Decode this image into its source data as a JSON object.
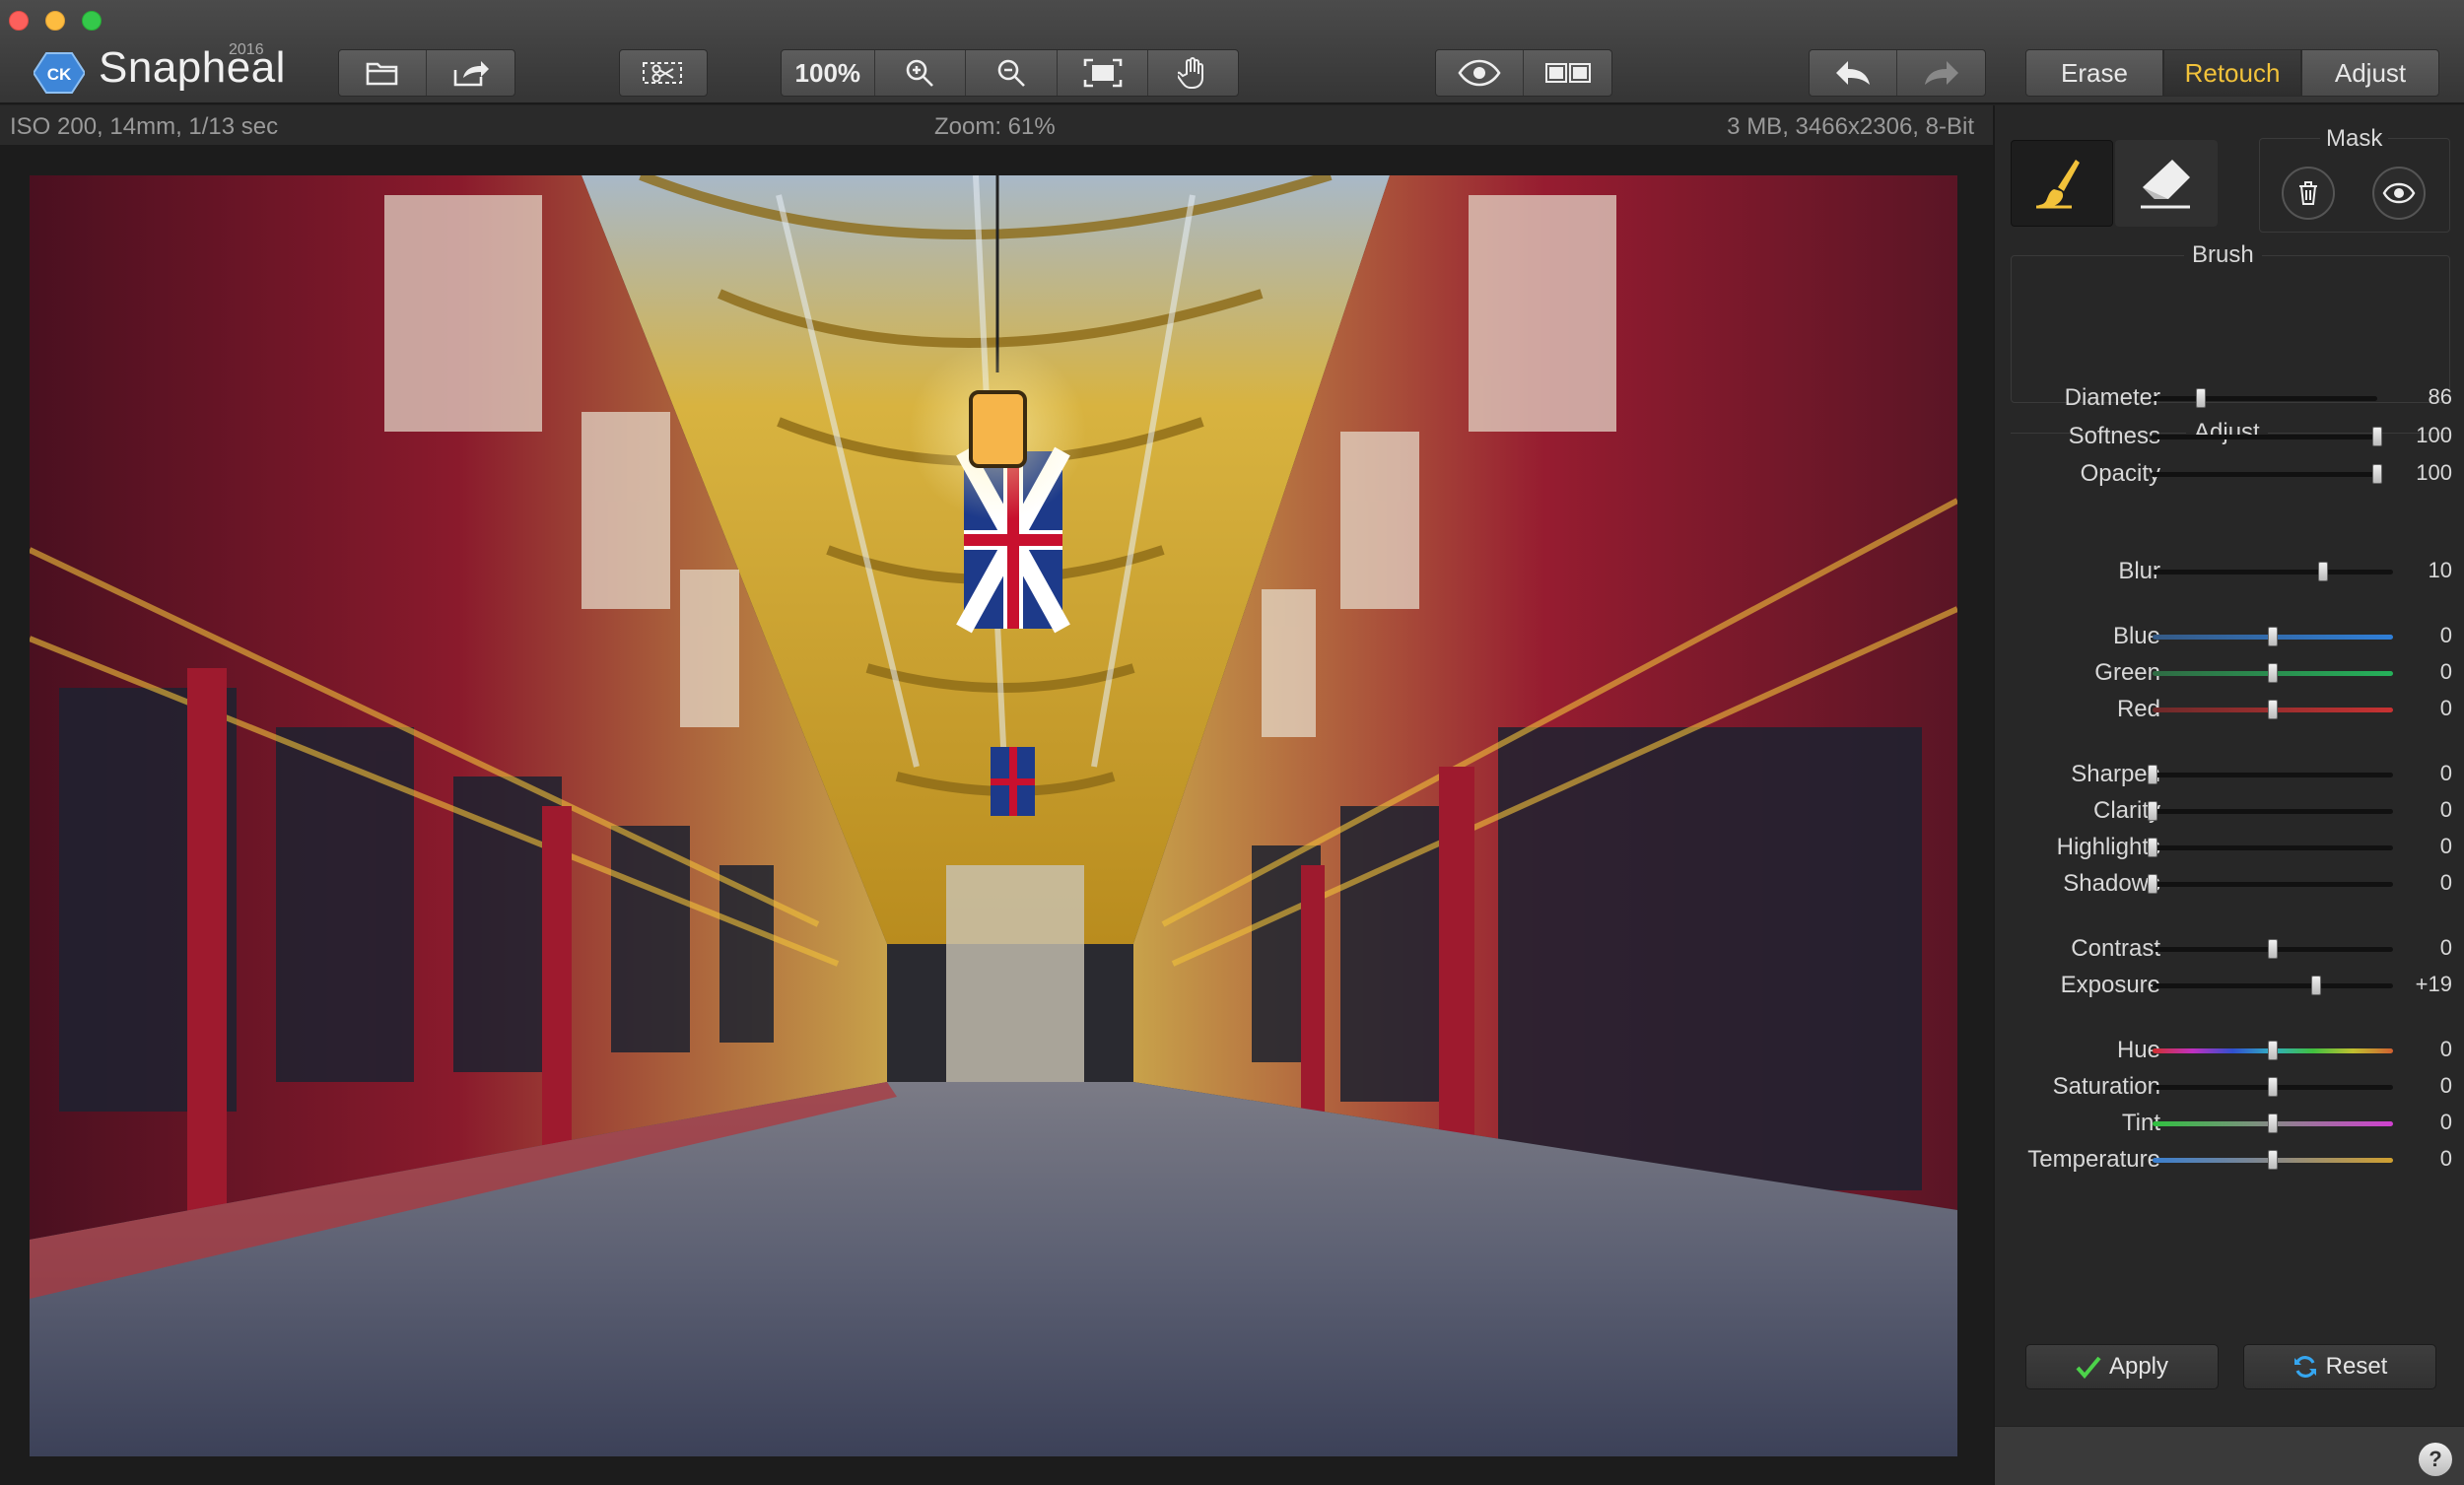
{
  "app": {
    "name": "Snapheal",
    "year": "2016",
    "logo_text": "CK"
  },
  "toolbar": {
    "zoom_100": "100%",
    "icons": [
      "folder-open-icon",
      "share-icon",
      "crop-scissors-icon",
      "zoom-in-icon",
      "zoom-out-icon",
      "fit-to-screen-icon",
      "hand-pan-icon",
      "preview-eye-icon",
      "compare-split-icon",
      "undo-icon",
      "redo-icon"
    ]
  },
  "mode_tabs": [
    {
      "label": "Erase",
      "active": false
    },
    {
      "label": "Retouch",
      "active": true
    },
    {
      "label": "Adjust",
      "active": false
    }
  ],
  "info": {
    "exif": "ISO 200, 14mm, 1/13 sec",
    "zoom": "Zoom: 61%",
    "file": "3 MB, 3466x2306, 8-Bit"
  },
  "panel": {
    "mask_label": "Mask",
    "brush_title": "Brush",
    "adjust_title": "Adjust",
    "brush_sliders": [
      {
        "label": "Diameter",
        "value": "86",
        "pos": 0.22
      },
      {
        "label": "Softness",
        "value": "100",
        "pos": 1.0
      },
      {
        "label": "Opacity",
        "value": "100",
        "pos": 1.0
      }
    ],
    "adjust_sliders": [
      {
        "label": "Blur",
        "value": "10",
        "pos": 0.71,
        "track": "plain"
      },
      {
        "label": "Blue",
        "value": "0",
        "pos": 0.5,
        "track": "blue"
      },
      {
        "label": "Green",
        "value": "0",
        "pos": 0.5,
        "track": "green"
      },
      {
        "label": "Red",
        "value": "0",
        "pos": 0.5,
        "track": "red"
      },
      {
        "label": "Sharpen",
        "value": "0",
        "pos": 0.0,
        "track": "plain"
      },
      {
        "label": "Clarity",
        "value": "0",
        "pos": 0.0,
        "track": "plain"
      },
      {
        "label": "Highlights",
        "value": "0",
        "pos": 0.0,
        "track": "plain"
      },
      {
        "label": "Shadows",
        "value": "0",
        "pos": 0.0,
        "track": "plain"
      },
      {
        "label": "Contrast",
        "value": "0",
        "pos": 0.5,
        "track": "plain"
      },
      {
        "label": "Exposure",
        "value": "+19",
        "pos": 0.68,
        "track": "plain"
      },
      {
        "label": "Hue",
        "value": "0",
        "pos": 0.5,
        "track": "hue"
      },
      {
        "label": "Saturation",
        "value": "0",
        "pos": 0.5,
        "track": "plain"
      },
      {
        "label": "Tint",
        "value": "0",
        "pos": 0.5,
        "track": "tint"
      },
      {
        "label": "Temperature",
        "value": "0",
        "pos": 0.5,
        "track": "temperature"
      }
    ],
    "apply_label": "Apply",
    "reset_label": "Reset",
    "help_label": "?"
  },
  "colors": {
    "accent": "#f2c23a",
    "bg": "#232323",
    "panel": "#272727"
  }
}
